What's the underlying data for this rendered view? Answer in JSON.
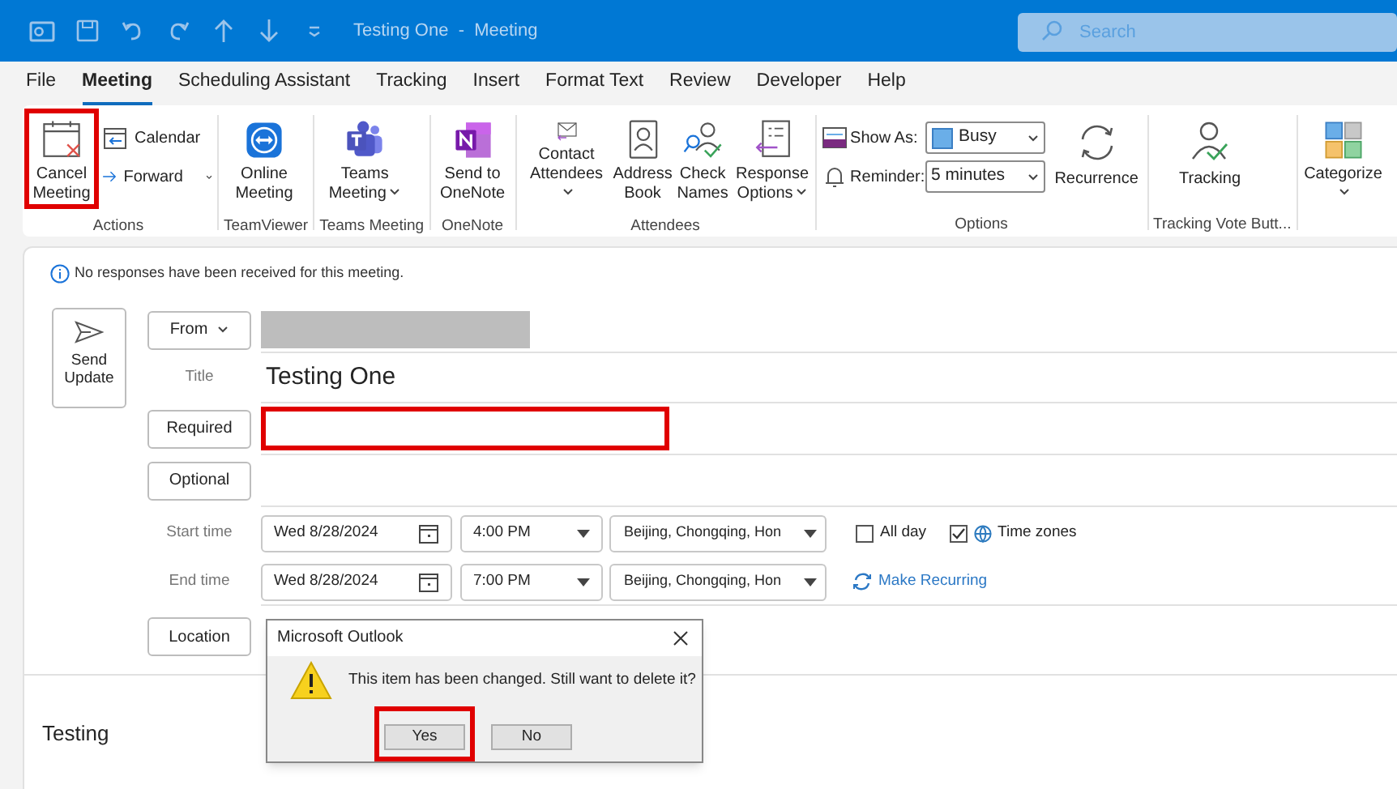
{
  "title_bar": {
    "title": "Testing One  -  Meeting",
    "search_placeholder": "Search"
  },
  "tabs": [
    {
      "label": "File",
      "selected": false
    },
    {
      "label": "Meeting",
      "selected": true
    },
    {
      "label": "Scheduling Assistant",
      "selected": false
    },
    {
      "label": "Tracking",
      "selected": false
    },
    {
      "label": "Insert",
      "selected": false
    },
    {
      "label": "Format Text",
      "selected": false
    },
    {
      "label": "Review",
      "selected": false
    },
    {
      "label": "Developer",
      "selected": false
    },
    {
      "label": "Help",
      "selected": false
    }
  ],
  "ribbon": [
    {
      "label": "Actions",
      "items": [
        {
          "kind": "large",
          "label": "Cancel Meeting",
          "highlighted": true
        },
        {
          "kind": "stack",
          "items": [
            {
              "label": "Calendar"
            },
            {
              "label": "Forward",
              "dropdown": true
            }
          ]
        }
      ]
    },
    {
      "label": "TeamViewer",
      "items": [
        {
          "kind": "large",
          "label": "Online Meeting"
        }
      ]
    },
    {
      "label": "Teams Meeting",
      "items": [
        {
          "kind": "large",
          "label": "Teams Meeting",
          "dropdown": true
        }
      ]
    },
    {
      "label": "OneNote",
      "items": [
        {
          "kind": "large",
          "label": "Send to OneNote"
        }
      ]
    },
    {
      "label": "Attendees",
      "items": [
        {
          "kind": "large",
          "label": "Contact Attendees",
          "dropdown": true
        },
        {
          "kind": "large",
          "label": "Address Book"
        },
        {
          "kind": "large",
          "label": "Check Names"
        },
        {
          "kind": "large",
          "label": "Response Options",
          "dropdown": true
        }
      ]
    },
    {
      "label": "Options",
      "items": [
        {
          "kind": "stack",
          "items": [
            {
              "label": "Show As:",
              "value": "Busy"
            },
            {
              "label": "Reminder:",
              "value": "5 minutes"
            }
          ]
        },
        {
          "kind": "large",
          "label": "Recurrence"
        }
      ]
    },
    {
      "label": "Tracking Vote Butt...",
      "items": [
        {
          "kind": "large",
          "label": "Tracking"
        }
      ]
    },
    {
      "items": [
        {
          "kind": "large",
          "label": "Categorize",
          "dropdown": true
        }
      ]
    }
  ],
  "form": {
    "info": "No responses have been received for this meeting.",
    "send_button": "Send Update",
    "from_button": "From",
    "title_label": "Title",
    "title_value": "Testing One",
    "required_button": "Required",
    "required_highlighted": true,
    "optional_button": "Optional",
    "start": {
      "label": "Start time",
      "date": "Wed 8/28/2024",
      "time": "4:00 PM",
      "timezone": "Beijing, Chongqing, Hon"
    },
    "end": {
      "label": "End time",
      "date": "Wed 8/28/2024",
      "time": "7:00 PM",
      "timezone": "Beijing, Chongqing, Hon"
    },
    "all_day": {
      "label": "All day",
      "checked": false
    },
    "time_zones": {
      "label": "Time zones",
      "checked": true
    },
    "make_recurring": "Make Recurring",
    "location_button": "Location",
    "body": "Testing"
  },
  "dialog": {
    "title": "Microsoft Outlook",
    "message": "This item has been changed. Still want to delete it?",
    "buttons": [
      {
        "label": "Yes",
        "highlighted": true
      },
      {
        "label": "No",
        "highlighted": false
      }
    ]
  }
}
